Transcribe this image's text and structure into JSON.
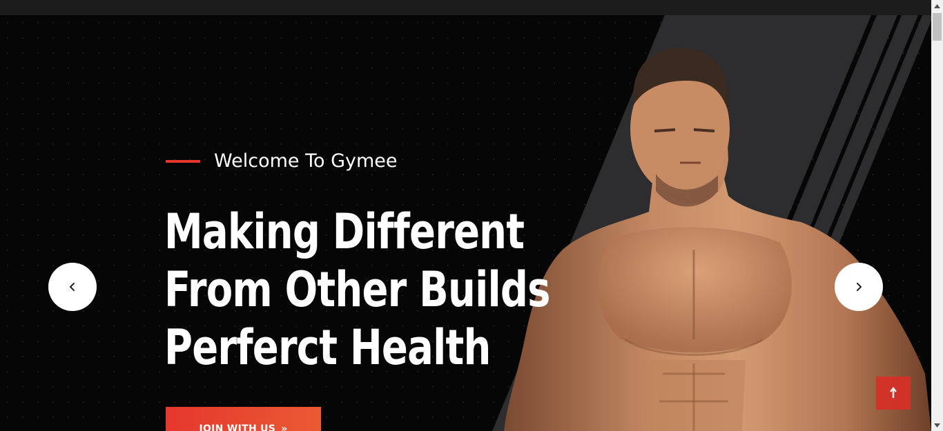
{
  "hero": {
    "welcome": "Welcome To Gymee",
    "headline": [
      "Making Different",
      "From Other Builds",
      "Perferct Health"
    ],
    "cta_label": "JOIN WITH US",
    "cta_icon": "double-chevron-right-icon"
  },
  "slider": {
    "prev_icon": "chevron-left-icon",
    "next_icon": "chevron-right-icon"
  },
  "scroll_top_icon": "arrow-up-icon",
  "colors": {
    "accent": "#e5372e",
    "background": "#060606",
    "text": "#ffffff"
  }
}
